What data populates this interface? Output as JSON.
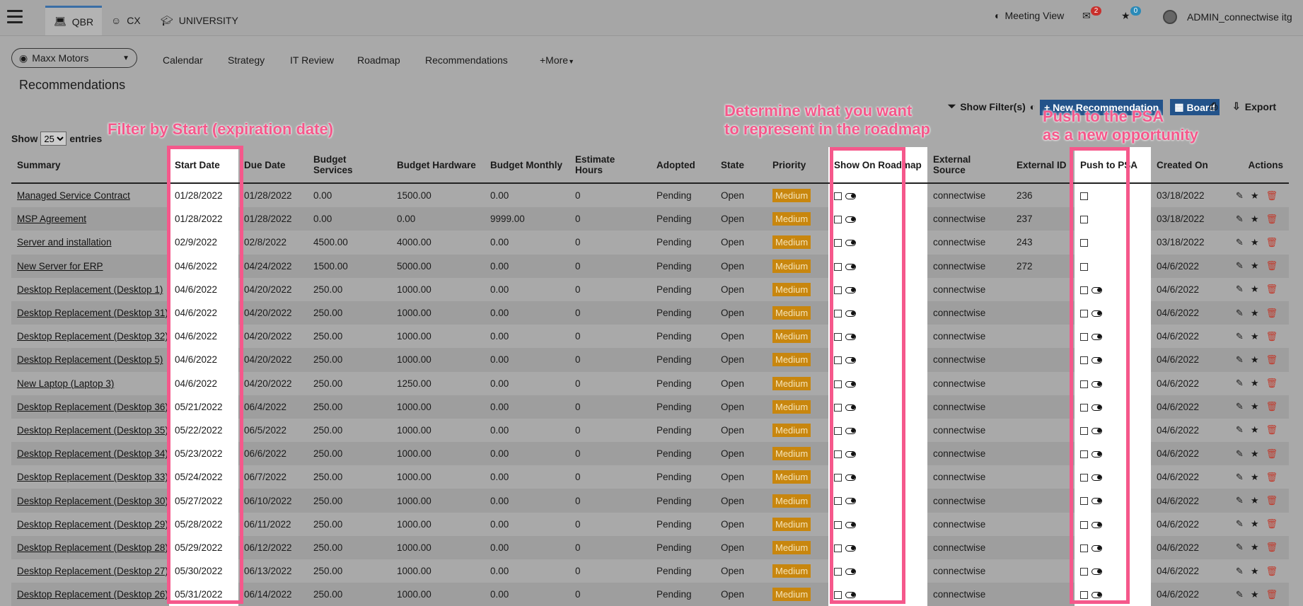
{
  "topbar": {
    "tabs": [
      {
        "label": "QBR",
        "icon": "laptop-icon"
      },
      {
        "label": "CX",
        "icon": "smiley-icon"
      },
      {
        "label": "UNIVERSITY",
        "icon": "graduation-cap-icon"
      }
    ],
    "meeting_view": "Meeting View",
    "mail_count": "2",
    "star_count": "0",
    "user": "ADMIN_connectwise itg"
  },
  "client": {
    "name": "Maxx Motors"
  },
  "subnav": [
    "Calendar",
    "Strategy",
    "IT Review",
    "Roadmap",
    "Recommendations",
    "+More"
  ],
  "page": {
    "title": "Recommendations"
  },
  "toolbar": {
    "filters": "Show Filter(s)",
    "new_rec": "+ New Recommendation",
    "board": "Board",
    "export": "Export"
  },
  "entries": {
    "show": "Show",
    "value": "25",
    "suffix": "entries"
  },
  "columns": [
    "Summary",
    "Start Date",
    "Due Date",
    "Budget Services",
    "Budget Hardware",
    "Budget Monthly",
    "Estimate Hours",
    "Adopted",
    "State",
    "Priority",
    "Show On Roadmap",
    "External Source",
    "External ID",
    "Push to PSA",
    "Created On",
    "Actions"
  ],
  "rows": [
    {
      "summary": "Managed Service Contract",
      "start": "01/28/2022",
      "due": "01/28/2022",
      "services": "0.00",
      "hardware": "1500.00",
      "monthly": "0.00",
      "hours": "0",
      "adopted": "Pending",
      "state": "Open",
      "priority": "Medium",
      "source": "connectwise",
      "ext_id": "236",
      "psa_toggle": false,
      "created": "03/18/2022"
    },
    {
      "summary": "MSP Agreement",
      "start": "01/28/2022",
      "due": "01/28/2022",
      "services": "0.00",
      "hardware": "0.00",
      "monthly": "9999.00",
      "hours": "0",
      "adopted": "Pending",
      "state": "Open",
      "priority": "Medium",
      "source": "connectwise",
      "ext_id": "237",
      "psa_toggle": false,
      "created": "03/18/2022"
    },
    {
      "summary": "Server and installation",
      "start": "02/9/2022",
      "due": "02/8/2022",
      "services": "4500.00",
      "hardware": "4000.00",
      "monthly": "0.00",
      "hours": "0",
      "adopted": "Pending",
      "state": "Open",
      "priority": "Medium",
      "source": "connectwise",
      "ext_id": "243",
      "psa_toggle": false,
      "created": "03/18/2022"
    },
    {
      "summary": "New Server for ERP",
      "start": "04/6/2022",
      "due": "04/24/2022",
      "services": "1500.00",
      "hardware": "5000.00",
      "monthly": "0.00",
      "hours": "0",
      "adopted": "Pending",
      "state": "Open",
      "priority": "Medium",
      "source": "connectwise",
      "ext_id": "272",
      "psa_toggle": false,
      "created": "04/6/2022"
    },
    {
      "summary": "Desktop Replacement (Desktop 1)",
      "start": "04/6/2022",
      "due": "04/20/2022",
      "services": "250.00",
      "hardware": "1000.00",
      "monthly": "0.00",
      "hours": "0",
      "adopted": "Pending",
      "state": "Open",
      "priority": "Medium",
      "source": "connectwise",
      "ext_id": "",
      "psa_toggle": true,
      "created": "04/6/2022"
    },
    {
      "summary": "Desktop Replacement (Desktop 31)",
      "start": "04/6/2022",
      "due": "04/20/2022",
      "services": "250.00",
      "hardware": "1000.00",
      "monthly": "0.00",
      "hours": "0",
      "adopted": "Pending",
      "state": "Open",
      "priority": "Medium",
      "source": "connectwise",
      "ext_id": "",
      "psa_toggle": true,
      "created": "04/6/2022"
    },
    {
      "summary": "Desktop Replacement (Desktop 32)",
      "start": "04/6/2022",
      "due": "04/20/2022",
      "services": "250.00",
      "hardware": "1000.00",
      "monthly": "0.00",
      "hours": "0",
      "adopted": "Pending",
      "state": "Open",
      "priority": "Medium",
      "source": "connectwise",
      "ext_id": "",
      "psa_toggle": true,
      "created": "04/6/2022"
    },
    {
      "summary": "Desktop Replacement (Desktop 5)",
      "start": "04/6/2022",
      "due": "04/20/2022",
      "services": "250.00",
      "hardware": "1000.00",
      "monthly": "0.00",
      "hours": "0",
      "adopted": "Pending",
      "state": "Open",
      "priority": "Medium",
      "source": "connectwise",
      "ext_id": "",
      "psa_toggle": true,
      "created": "04/6/2022"
    },
    {
      "summary": "New Laptop (Laptop 3)",
      "start": "04/6/2022",
      "due": "04/20/2022",
      "services": "250.00",
      "hardware": "1250.00",
      "monthly": "0.00",
      "hours": "0",
      "adopted": "Pending",
      "state": "Open",
      "priority": "Medium",
      "source": "connectwise",
      "ext_id": "",
      "psa_toggle": true,
      "created": "04/6/2022"
    },
    {
      "summary": "Desktop Replacement (Desktop 36)",
      "start": "05/21/2022",
      "due": "06/4/2022",
      "services": "250.00",
      "hardware": "1000.00",
      "monthly": "0.00",
      "hours": "0",
      "adopted": "Pending",
      "state": "Open",
      "priority": "Medium",
      "source": "connectwise",
      "ext_id": "",
      "psa_toggle": true,
      "created": "04/6/2022"
    },
    {
      "summary": "Desktop Replacement (Desktop 35)",
      "start": "05/22/2022",
      "due": "06/5/2022",
      "services": "250.00",
      "hardware": "1000.00",
      "monthly": "0.00",
      "hours": "0",
      "adopted": "Pending",
      "state": "Open",
      "priority": "Medium",
      "source": "connectwise",
      "ext_id": "",
      "psa_toggle": true,
      "created": "04/6/2022"
    },
    {
      "summary": "Desktop Replacement (Desktop 34)",
      "start": "05/23/2022",
      "due": "06/6/2022",
      "services": "250.00",
      "hardware": "1000.00",
      "monthly": "0.00",
      "hours": "0",
      "adopted": "Pending",
      "state": "Open",
      "priority": "Medium",
      "source": "connectwise",
      "ext_id": "",
      "psa_toggle": true,
      "created": "04/6/2022"
    },
    {
      "summary": "Desktop Replacement (Desktop 33)",
      "start": "05/24/2022",
      "due": "06/7/2022",
      "services": "250.00",
      "hardware": "1000.00",
      "monthly": "0.00",
      "hours": "0",
      "adopted": "Pending",
      "state": "Open",
      "priority": "Medium",
      "source": "connectwise",
      "ext_id": "",
      "psa_toggle": true,
      "created": "04/6/2022"
    },
    {
      "summary": "Desktop Replacement (Desktop 30)",
      "start": "05/27/2022",
      "due": "06/10/2022",
      "services": "250.00",
      "hardware": "1000.00",
      "monthly": "0.00",
      "hours": "0",
      "adopted": "Pending",
      "state": "Open",
      "priority": "Medium",
      "source": "connectwise",
      "ext_id": "",
      "psa_toggle": true,
      "created": "04/6/2022"
    },
    {
      "summary": "Desktop Replacement (Desktop 29)",
      "start": "05/28/2022",
      "due": "06/11/2022",
      "services": "250.00",
      "hardware": "1000.00",
      "monthly": "0.00",
      "hours": "0",
      "adopted": "Pending",
      "state": "Open",
      "priority": "Medium",
      "source": "connectwise",
      "ext_id": "",
      "psa_toggle": true,
      "created": "04/6/2022"
    },
    {
      "summary": "Desktop Replacement (Desktop 28)",
      "start": "05/29/2022",
      "due": "06/12/2022",
      "services": "250.00",
      "hardware": "1000.00",
      "monthly": "0.00",
      "hours": "0",
      "adopted": "Pending",
      "state": "Open",
      "priority": "Medium",
      "source": "connectwise",
      "ext_id": "",
      "psa_toggle": true,
      "created": "04/6/2022"
    },
    {
      "summary": "Desktop Replacement (Desktop 27)",
      "start": "05/30/2022",
      "due": "06/13/2022",
      "services": "250.00",
      "hardware": "1000.00",
      "monthly": "0.00",
      "hours": "0",
      "adopted": "Pending",
      "state": "Open",
      "priority": "Medium",
      "source": "connectwise",
      "ext_id": "",
      "psa_toggle": true,
      "created": "04/6/2022"
    },
    {
      "summary": "Desktop Replacement (Desktop 26)",
      "start": "05/31/2022",
      "due": "06/14/2022",
      "services": "250.00",
      "hardware": "1000.00",
      "monthly": "0.00",
      "hours": "0",
      "adopted": "Pending",
      "state": "Open",
      "priority": "Medium",
      "source": "connectwise",
      "ext_id": "",
      "psa_toggle": true,
      "created": "04/6/2022"
    }
  ],
  "annotations": {
    "start_filter": "Filter by Start (expiration date)",
    "roadmap": "Determine what you want\nto represent in the roadmap",
    "psa": "Push to the PSA\nas a new opportunity"
  },
  "colors": {
    "highlight": "#f5588b",
    "priority": "#c8860e",
    "button": "#23538a"
  }
}
